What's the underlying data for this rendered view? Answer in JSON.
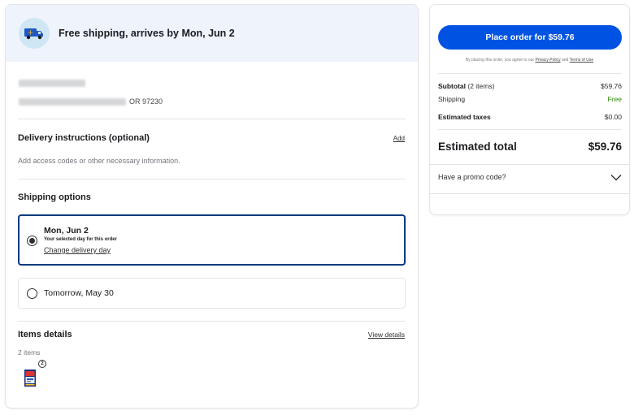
{
  "shipping_banner": {
    "icon": "delivery-truck-icon",
    "text": "Free shipping, arrives by Mon, Jun 2"
  },
  "address": {
    "zip_text": "OR 97230"
  },
  "delivery_instructions": {
    "title": "Delivery instructions (optional)",
    "add_label": "Add",
    "hint": "Add access codes or other necessary information."
  },
  "shipping_options": {
    "title": "Shipping options",
    "options": [
      {
        "date": "Mon, Jun 2",
        "subtitle": "Your selected day for this order",
        "change_label": "Change delivery day",
        "selected": true
      },
      {
        "date": "Tomorrow, May 30",
        "selected": false
      }
    ]
  },
  "items_details": {
    "title": "Items details",
    "view_label": "View details",
    "count_text": "2 items",
    "quantity_badge": "2"
  },
  "order_summary": {
    "place_order_label": "Place order for $59.76",
    "legal_prefix": "By placing this order, you agree to our",
    "privacy_label": "Privacy Policy",
    "legal_and": "and",
    "terms_label": "Terms of Use",
    "subtotal_label": "Subtotal",
    "subtotal_items": "(2 items)",
    "subtotal_value": "$59.76",
    "shipping_label": "Shipping",
    "shipping_value": "Free",
    "taxes_label": "Estimated taxes",
    "taxes_value": "$0.00",
    "total_label": "Estimated total",
    "total_value": "$59.76",
    "promo_label": "Have a promo code?"
  },
  "colors": {
    "primary_button": "#0053e2",
    "selected_border": "#003b7e",
    "free_text": "#2a8703",
    "banner_bg": "#eef3fc"
  }
}
